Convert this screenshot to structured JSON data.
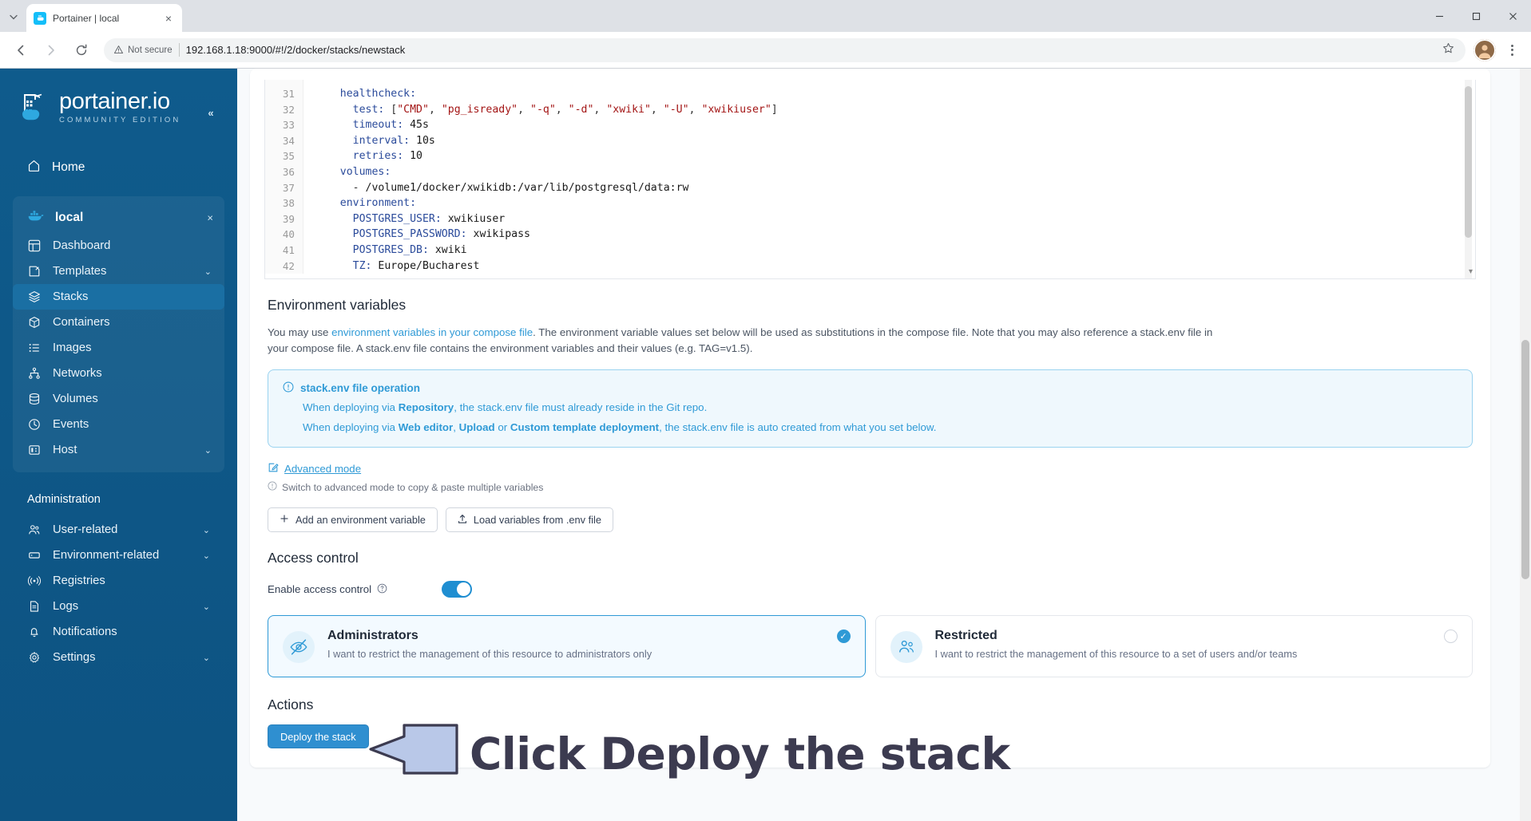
{
  "browser": {
    "tab": {
      "title": "Portainer | local",
      "favicon": "portainer-favicon",
      "close_label": "×"
    },
    "tab_search_icon": "chevron-down-icon",
    "window": {
      "minimize": "─",
      "maximize": "□",
      "close": "✕"
    },
    "nav": {
      "back": "back-arrow-icon",
      "forward": "forward-arrow-icon",
      "reload": "reload-icon"
    },
    "omnibox": {
      "security_label": "Not secure",
      "url": "192.168.1.18:9000/#!/2/docker/stacks/newstack",
      "star_icon": "bookmark-star-icon"
    },
    "profile_icon": "user-avatar",
    "menu_icon": "three-dot-menu-icon"
  },
  "sidebar": {
    "brand": {
      "name": "portainer.io",
      "edition": "COMMUNITY EDITION"
    },
    "collapse_label": "«",
    "home": {
      "label": "Home",
      "icon": "home-icon"
    },
    "environment": {
      "name": "local",
      "icon": "docker-whale-icon",
      "close": "×"
    },
    "env_items": [
      {
        "label": "Dashboard",
        "icon": "dashboard-icon",
        "chevron": "",
        "active": false
      },
      {
        "label": "Templates",
        "icon": "templates-icon",
        "chevron": "⌄",
        "active": false
      },
      {
        "label": "Stacks",
        "icon": "stacks-icon",
        "chevron": "",
        "active": true
      },
      {
        "label": "Containers",
        "icon": "containers-icon",
        "chevron": "",
        "active": false
      },
      {
        "label": "Images",
        "icon": "images-icon",
        "chevron": "",
        "active": false
      },
      {
        "label": "Networks",
        "icon": "networks-icon",
        "chevron": "",
        "active": false
      },
      {
        "label": "Volumes",
        "icon": "volumes-icon",
        "chevron": "",
        "active": false
      },
      {
        "label": "Events",
        "icon": "events-clock-icon",
        "chevron": "",
        "active": false
      },
      {
        "label": "Host",
        "icon": "host-icon",
        "chevron": "⌄",
        "active": false
      }
    ],
    "admin_title": "Administration",
    "admin_items": [
      {
        "label": "User-related",
        "icon": "users-icon",
        "chevron": "⌄"
      },
      {
        "label": "Environment-related",
        "icon": "environment-icon",
        "chevron": "⌄"
      },
      {
        "label": "Registries",
        "icon": "registries-icon",
        "chevron": ""
      },
      {
        "label": "Logs",
        "icon": "logs-icon",
        "chevron": "⌄"
      },
      {
        "label": "Notifications",
        "icon": "bell-icon",
        "chevron": ""
      },
      {
        "label": "Settings",
        "icon": "gear-icon",
        "chevron": "⌄"
      }
    ]
  },
  "editor": {
    "lines": [
      {
        "n": "31",
        "indent": 4,
        "tokens": [
          {
            "t": "healthcheck:",
            "c": "k"
          }
        ]
      },
      {
        "n": "32",
        "indent": 6,
        "tokens": [
          {
            "t": "test:",
            "c": "k"
          },
          {
            "t": " [",
            "c": "p"
          },
          {
            "t": "\"CMD\"",
            "c": "s"
          },
          {
            "t": ", ",
            "c": "p"
          },
          {
            "t": "\"pg_isready\"",
            "c": "s"
          },
          {
            "t": ", ",
            "c": "p"
          },
          {
            "t": "\"-q\"",
            "c": "s"
          },
          {
            "t": ", ",
            "c": "p"
          },
          {
            "t": "\"-d\"",
            "c": "s"
          },
          {
            "t": ", ",
            "c": "p"
          },
          {
            "t": "\"xwiki\"",
            "c": "s"
          },
          {
            "t": ", ",
            "c": "p"
          },
          {
            "t": "\"-U\"",
            "c": "s"
          },
          {
            "t": ", ",
            "c": "p"
          },
          {
            "t": "\"xwikiuser\"",
            "c": "s"
          },
          {
            "t": "]",
            "c": "p"
          }
        ]
      },
      {
        "n": "33",
        "indent": 6,
        "tokens": [
          {
            "t": "timeout:",
            "c": "k"
          },
          {
            "t": " 45s",
            "c": "v"
          }
        ]
      },
      {
        "n": "34",
        "indent": 6,
        "tokens": [
          {
            "t": "interval:",
            "c": "k"
          },
          {
            "t": " 10s",
            "c": "v"
          }
        ]
      },
      {
        "n": "35",
        "indent": 6,
        "tokens": [
          {
            "t": "retries:",
            "c": "k"
          },
          {
            "t": " 10",
            "c": "v"
          }
        ]
      },
      {
        "n": "36",
        "indent": 4,
        "tokens": [
          {
            "t": "volumes:",
            "c": "k"
          }
        ]
      },
      {
        "n": "37",
        "indent": 6,
        "tokens": [
          {
            "t": "- ",
            "c": "p"
          },
          {
            "t": "/volume1/docker/xwikidb:/var/lib/postgresql/data:rw",
            "c": "v"
          }
        ]
      },
      {
        "n": "38",
        "indent": 4,
        "tokens": [
          {
            "t": "environment:",
            "c": "k"
          }
        ]
      },
      {
        "n": "39",
        "indent": 6,
        "tokens": [
          {
            "t": "POSTGRES_USER:",
            "c": "k"
          },
          {
            "t": " xwikiuser",
            "c": "v"
          }
        ]
      },
      {
        "n": "40",
        "indent": 6,
        "tokens": [
          {
            "t": "POSTGRES_PASSWORD:",
            "c": "k"
          },
          {
            "t": " xwikipass",
            "c": "v"
          }
        ]
      },
      {
        "n": "41",
        "indent": 6,
        "tokens": [
          {
            "t": "POSTGRES_DB:",
            "c": "k"
          },
          {
            "t": " xwiki",
            "c": "v"
          }
        ]
      },
      {
        "n": "42",
        "indent": 6,
        "tokens": [
          {
            "t": "TZ:",
            "c": "k"
          },
          {
            "t": " Europe/Bucharest",
            "c": "v"
          }
        ]
      }
    ]
  },
  "env_section": {
    "title": "Environment variables",
    "para_before_link": "You may use ",
    "link_text": "environment variables in your compose file",
    "para_after_link": ". The environment variable values set below will be used as substitutions in the compose file. Note that you may also reference a stack.env file in your compose file. A stack.env file contains the environment variables and their values (e.g. TAG=v1.5).",
    "info": {
      "icon": "info-circle-icon",
      "title": "stack.env file operation",
      "line1_a": "When deploying via ",
      "line1_b": "Repository",
      "line1_c": ", the stack.env file must already reside in the Git repo.",
      "line2_a": "When deploying via ",
      "line2_b": "Web editor",
      "line2_c": ", ",
      "line2_d": "Upload",
      "line2_e": " or ",
      "line2_f": "Custom template deployment",
      "line2_g": ", the stack.env file is auto created from what you set below."
    },
    "advanced_mode": {
      "icon": "edit-pencil-icon",
      "label": "Advanced mode"
    },
    "advanced_note": {
      "icon": "info-circle-icon",
      "text": "Switch to advanced mode to copy & paste multiple variables"
    },
    "buttons": [
      {
        "icon": "plus-icon",
        "label": "Add an environment variable"
      },
      {
        "icon": "upload-icon",
        "label": "Load variables from .env file"
      }
    ]
  },
  "access_control": {
    "title": "Access control",
    "toggle_label": "Enable access control",
    "toggle_help_icon": "question-circle-icon",
    "toggle_on": true,
    "options": [
      {
        "title": "Administrators",
        "desc": "I want to restrict the management of this resource to administrators only",
        "icon": "eye-off-icon",
        "selected": true,
        "check": "✓"
      },
      {
        "title": "Restricted",
        "desc": "I want to restrict the management of this resource to a set of users and/or teams",
        "icon": "users-group-icon",
        "selected": false,
        "check": ""
      }
    ]
  },
  "actions": {
    "title": "Actions",
    "deploy_label": "Deploy the stack"
  },
  "annotation": {
    "arrow_icon": "left-arrow-annotation",
    "text": "Click Deploy the stack",
    "arrow_fill": "#b9c8e8",
    "arrow_stroke": "#3c3b50",
    "text_color": "#3c3b50"
  },
  "colors": {
    "sidebar_bg": "#0f5b8c",
    "accent": "#2f9ad6",
    "deploy_btn": "#2f8fd0",
    "active_nav": "#1a6fa3"
  }
}
